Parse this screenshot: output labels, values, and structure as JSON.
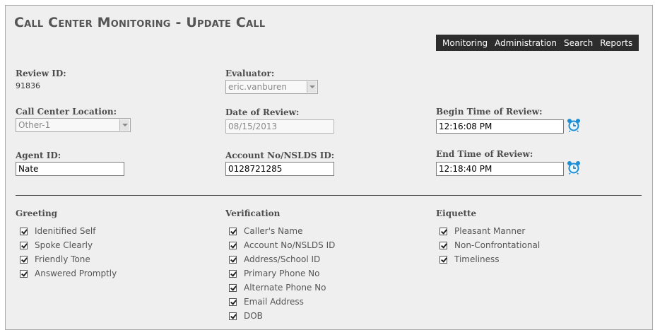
{
  "page": {
    "title": "Call Center Monitoring - Update Call"
  },
  "nav": {
    "items": [
      "Monitoring",
      "Administration",
      "Search",
      "Reports"
    ]
  },
  "form": {
    "review_id": {
      "label": "Review ID:",
      "value": "91836"
    },
    "evaluator": {
      "label": "Evaluator:",
      "value": "eric.vanburen"
    },
    "call_center_location": {
      "label": "Call Center Location:",
      "value": "Other-1"
    },
    "date_of_review": {
      "label": "Date of Review:",
      "value": "08/15/2013"
    },
    "begin_time": {
      "label": "Begin Time of Review:",
      "value": "12:16:08 PM"
    },
    "agent_id": {
      "label": "Agent ID:",
      "value": "Nate"
    },
    "account_no": {
      "label": "Account No/NSLDS ID:",
      "value": "0128721285"
    },
    "end_time": {
      "label": "End Time of Review:",
      "value": "12:18:40 PM"
    }
  },
  "sections": {
    "greeting": {
      "title": "Greeting",
      "items": [
        {
          "label": "Idenitified Self",
          "checked": true
        },
        {
          "label": "Spoke Clearly",
          "checked": true
        },
        {
          "label": "Friendly Tone",
          "checked": true
        },
        {
          "label": "Answered Promptly",
          "checked": true
        }
      ]
    },
    "verification": {
      "title": "Verification",
      "items": [
        {
          "label": "Caller's Name",
          "checked": true
        },
        {
          "label": "Account No/NSLDS ID",
          "checked": true
        },
        {
          "label": "Address/School ID",
          "checked": true
        },
        {
          "label": "Primary Phone No",
          "checked": true
        },
        {
          "label": "Alternate Phone No",
          "checked": true
        },
        {
          "label": "Email Address",
          "checked": true
        },
        {
          "label": "DOB",
          "checked": true
        }
      ]
    },
    "etiquette": {
      "title": "Eiquette",
      "items": [
        {
          "label": "Pleasant Manner",
          "checked": true
        },
        {
          "label": "Non-Confrontational",
          "checked": true
        },
        {
          "label": "Timeliness",
          "checked": true
        }
      ]
    }
  },
  "icons": {
    "clock": "alarm-clock-icon",
    "accent": "#1e8fd6"
  }
}
